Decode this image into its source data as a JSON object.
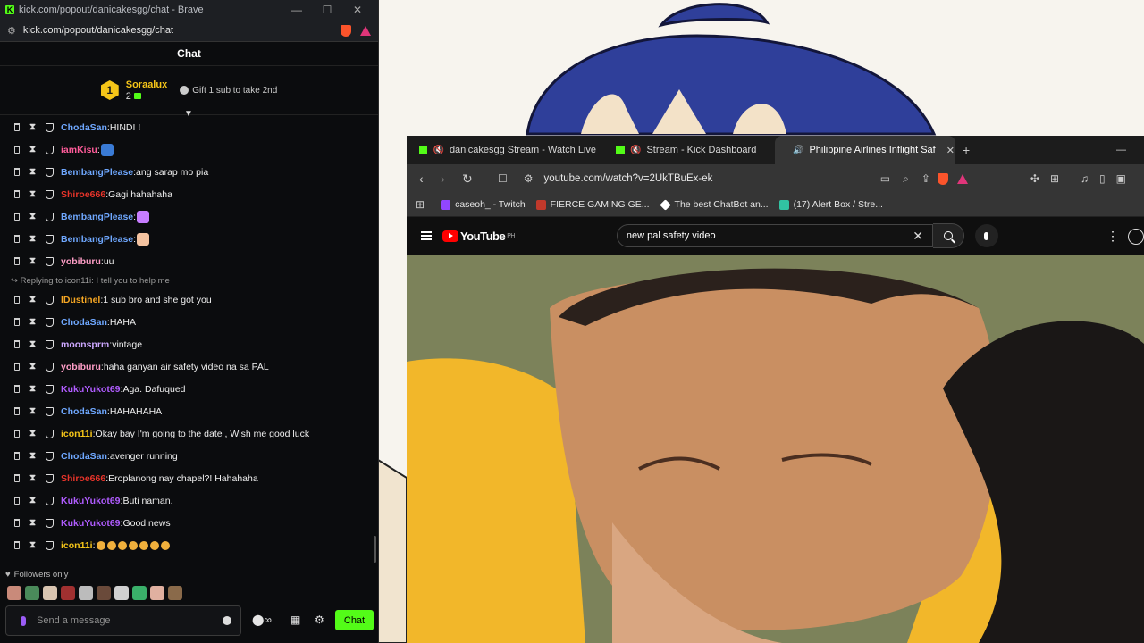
{
  "kick": {
    "window_title": "kick.com/popout/danicakesgg/chat - Brave",
    "url": "kick.com/popout/danicakesgg/chat",
    "header": "Chat",
    "pinned": {
      "rank": "1",
      "name": "Soraalux",
      "count": "2",
      "gift_text": "Gift 1 sub to take 2nd"
    },
    "messages": [
      {
        "user": "ChodaSan",
        "color": "#6fa8ff",
        "text": "HINDI !"
      },
      {
        "user": "iamKisu",
        "color": "#ff5c9a",
        "text": "",
        "emote": "#3a7bd5"
      },
      {
        "user": "BembangPlease",
        "color": "#6fa8ff",
        "text": "ang sarap mo pia"
      },
      {
        "user": "Shiroe666",
        "color": "#e8342a",
        "text": "Gagi hahahaha"
      },
      {
        "user": "BembangPlease",
        "color": "#6fa8ff",
        "text": "",
        "emote": "#c77dff"
      },
      {
        "user": "BembangPlease",
        "color": "#6fa8ff",
        "text": "",
        "emote": "#f4c3a0"
      },
      {
        "user": "yobiburu",
        "color": "#ff9ec7",
        "text": "uu"
      },
      {
        "user": "IDustinel",
        "color": "#f5a623",
        "text": "1 sub bro and she got you"
      },
      {
        "user": "ChodaSan",
        "color": "#6fa8ff",
        "text": "HAHA"
      },
      {
        "user": "moonsprm",
        "color": "#cda8ff",
        "text": "vintage"
      },
      {
        "user": "yobiburu",
        "color": "#ff9ec7",
        "text": "haha ganyan air safety video na sa PAL"
      },
      {
        "user": "KukuYukot69",
        "color": "#b05cff",
        "text": "Aga. Dafuqued"
      },
      {
        "user": "ChodaSan",
        "color": "#6fa8ff",
        "text": "HAHAHAHA"
      },
      {
        "user": "icon11i",
        "color": "#f5c518",
        "text": "Okay bay I'm going to the date , Wish me good luck"
      },
      {
        "user": "ChodaSan",
        "color": "#6fa8ff",
        "text": "avenger running"
      },
      {
        "user": "Shiroe666",
        "color": "#e8342a",
        "text": "Eroplanong nay chapel?! Hahahaha"
      },
      {
        "user": "KukuYukot69",
        "color": "#b05cff",
        "text": "Buti naman."
      },
      {
        "user": "KukuYukot69",
        "color": "#b05cff",
        "text": "Good news"
      },
      {
        "user": "icon11i",
        "color": "#f5c518",
        "text": "",
        "faces": 7
      }
    ],
    "reply_text": "Replying to icon11i: I tell you to help me",
    "followers_only": "Followers only",
    "input_placeholder": "Send a message",
    "chat_button": "Chat"
  },
  "browser": {
    "tabs": [
      {
        "label": "danicakesgg Stream - Watch Live",
        "icon": "kick-icon"
      },
      {
        "label": "Stream - Kick Dashboard",
        "icon": "kick-icon"
      },
      {
        "label": "Philippine Airlines Inflight Saf",
        "icon": "youtube-icon",
        "active": true
      }
    ],
    "url": "youtube.com/watch?v=2UkTBuEx-ek",
    "bookmarks": [
      {
        "label": "caseoh_ - Twitch",
        "color": "#9146ff"
      },
      {
        "label": "FIERCE GAMING GE...",
        "color": "#c0392b"
      },
      {
        "label": "The best ChatBot an...",
        "color": "#ffffff"
      },
      {
        "label": "(17) Alert Box / Stre...",
        "color": "#31c3a2"
      }
    ],
    "youtube": {
      "logo": "YouTube",
      "region": "PH",
      "search_value": "new pal safety video"
    }
  }
}
